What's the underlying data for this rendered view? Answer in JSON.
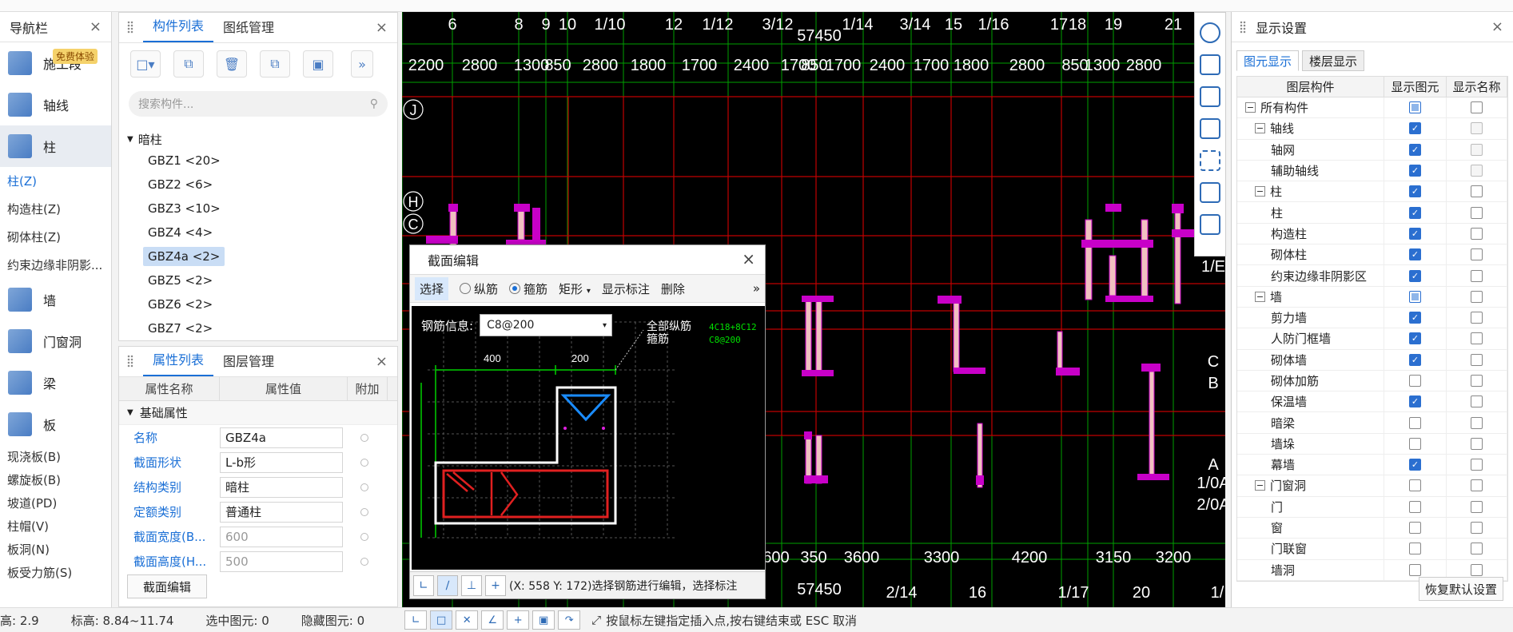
{
  "nav": {
    "title": "导航栏",
    "badge": "免费体验",
    "items": [
      {
        "label": "施工段",
        "icon": "construction-section-icon"
      },
      {
        "label": "轴线",
        "icon": "axis-grid-icon"
      },
      {
        "label": "柱",
        "icon": "column-icon"
      }
    ],
    "column_subs": [
      "柱(Z)",
      "构造柱(Z)",
      "砌体柱(Z)",
      "约束边缘非阴影..."
    ],
    "items2": [
      {
        "label": "墙",
        "icon": "wall-icon"
      },
      {
        "label": "门窗洞",
        "icon": "door-window-icon"
      },
      {
        "label": "梁",
        "icon": "beam-icon"
      },
      {
        "label": "板",
        "icon": "slab-icon"
      }
    ],
    "slab_subs": [
      "现浇板(B)",
      "螺旋板(B)",
      "坡道(PD)",
      "柱帽(V)",
      "板洞(N)",
      "板受力筋(S)"
    ]
  },
  "components": {
    "tabs": [
      "构件列表",
      "图纸管理"
    ],
    "search_placeholder": "搜索构件...",
    "group": "暗柱",
    "items": [
      "GBZ1 <20>",
      "GBZ2 <6>",
      "GBZ3 <10>",
      "GBZ4 <4>",
      "GBZ4a <2>",
      "GBZ5 <2>",
      "GBZ6 <2>",
      "GBZ7 <2>"
    ],
    "selected": "GBZ4a <2>"
  },
  "properties": {
    "tabs": [
      "属性列表",
      "图层管理"
    ],
    "headers": [
      "属性名称",
      "属性值",
      "附加"
    ],
    "section": "基础属性",
    "rows": [
      {
        "k": "名称",
        "v": "GBZ4a"
      },
      {
        "k": "截面形状",
        "v": "L-b形"
      },
      {
        "k": "结构类别",
        "v": "暗柱"
      },
      {
        "k": "定额类别",
        "v": "普通柱"
      },
      {
        "k": "截面宽度(B...",
        "v": "600"
      },
      {
        "k": "截面高度(H...",
        "v": "500"
      }
    ],
    "edit_button": "截面编辑"
  },
  "canvas": {
    "top_axis_labels": [
      "6",
      "8",
      "9",
      "10",
      "1/10",
      "12",
      "1/12",
      "3/12",
      "1/14",
      "3/14",
      "15",
      "1/16",
      "17",
      "18",
      "19",
      "21"
    ],
    "top_total": "57450",
    "top_dims": [
      "2200",
      "2800",
      "1300",
      "850",
      "2800",
      "1800",
      "1700",
      "2400",
      "1700",
      "850",
      "1700",
      "2400",
      "1700",
      "1800",
      "2800",
      "850",
      "1300",
      "2800"
    ],
    "bottom_dims": [
      "600",
      "350",
      "3600",
      "3300",
      "4200",
      "3150",
      "3200"
    ],
    "bottom_total": "57450",
    "bottom_axis_labels": [
      "2/14",
      "16",
      "1/17",
      "20",
      "1/"
    ],
    "left_axis_labels": [
      "J",
      "H",
      "C"
    ],
    "right_axis_labels": [
      "1/E",
      "C",
      "B",
      "A",
      "1/0A",
      "2/0A"
    ]
  },
  "dialog": {
    "title": "截面编辑",
    "tool_select": "选择",
    "radio_long": "纵筋",
    "radio_stirrup": "箍筋",
    "shape": "矩形",
    "show_label": "显示标注",
    "delete": "删除",
    "rebar_label": "钢筋信息:",
    "rebar_value": "C8@200",
    "note_all": "全部纵筋",
    "note_stirrup": "箍筋",
    "green_top": "4C18+8C12",
    "green_bottom": "C8@200",
    "dim_400": "400",
    "dim_200": "200",
    "status_text": "(X: 558 Y: 172)选择钢筋进行编辑，选择标注"
  },
  "display": {
    "title": "显示设置",
    "tabs": [
      "图元显示",
      "楼层显示"
    ],
    "headers": [
      "图层构件",
      "显示图元",
      "显示名称"
    ],
    "rows": [
      {
        "name": "所有构件",
        "level": 0,
        "exp": "−",
        "show": "part",
        "nm": "off"
      },
      {
        "name": "轴线",
        "level": 1,
        "exp": "−",
        "show": "on",
        "nm": "dis"
      },
      {
        "name": "轴网",
        "level": 2,
        "exp": "",
        "show": "on",
        "nm": "dis"
      },
      {
        "name": "辅助轴线",
        "level": 2,
        "exp": "",
        "show": "on",
        "nm": "dis"
      },
      {
        "name": "柱",
        "level": 1,
        "exp": "−",
        "show": "on",
        "nm": "off"
      },
      {
        "name": "柱",
        "level": 2,
        "exp": "",
        "show": "on",
        "nm": "off"
      },
      {
        "name": "构造柱",
        "level": 2,
        "exp": "",
        "show": "on",
        "nm": "off"
      },
      {
        "name": "砌体柱",
        "level": 2,
        "exp": "",
        "show": "on",
        "nm": "off"
      },
      {
        "name": "约束边缘非阴影区",
        "level": 2,
        "exp": "",
        "show": "on",
        "nm": "off"
      },
      {
        "name": "墙",
        "level": 1,
        "exp": "−",
        "show": "part",
        "nm": "off"
      },
      {
        "name": "剪力墙",
        "level": 2,
        "exp": "",
        "show": "on",
        "nm": "off"
      },
      {
        "name": "人防门框墙",
        "level": 2,
        "exp": "",
        "show": "on",
        "nm": "off"
      },
      {
        "name": "砌体墙",
        "level": 2,
        "exp": "",
        "show": "on",
        "nm": "off"
      },
      {
        "name": "砌体加筋",
        "level": 2,
        "exp": "",
        "show": "off",
        "nm": "off"
      },
      {
        "name": "保温墙",
        "level": 2,
        "exp": "",
        "show": "on",
        "nm": "off"
      },
      {
        "name": "暗梁",
        "level": 2,
        "exp": "",
        "show": "off",
        "nm": "off"
      },
      {
        "name": "墙垛",
        "level": 2,
        "exp": "",
        "show": "off",
        "nm": "off"
      },
      {
        "name": "幕墙",
        "level": 2,
        "exp": "",
        "show": "on",
        "nm": "off"
      },
      {
        "name": "门窗洞",
        "level": 1,
        "exp": "−",
        "show": "off",
        "nm": "off"
      },
      {
        "name": "门",
        "level": 2,
        "exp": "",
        "show": "off",
        "nm": "off"
      },
      {
        "name": "窗",
        "level": 2,
        "exp": "",
        "show": "off",
        "nm": "off"
      },
      {
        "name": "门联窗",
        "level": 2,
        "exp": "",
        "show": "off",
        "nm": "off"
      },
      {
        "name": "墙洞",
        "level": 2,
        "exp": "",
        "show": "off",
        "nm": "off"
      }
    ],
    "restore": "恢复默认设置"
  },
  "status": {
    "layer_height": "高: 2.9",
    "elevation": "标高: 8.84~11.74",
    "selected": "选中图元: 0",
    "hidden": "隐藏图元: 0",
    "hint": "按鼠标左键指定插入点,按右键结束或 ESC 取消"
  }
}
